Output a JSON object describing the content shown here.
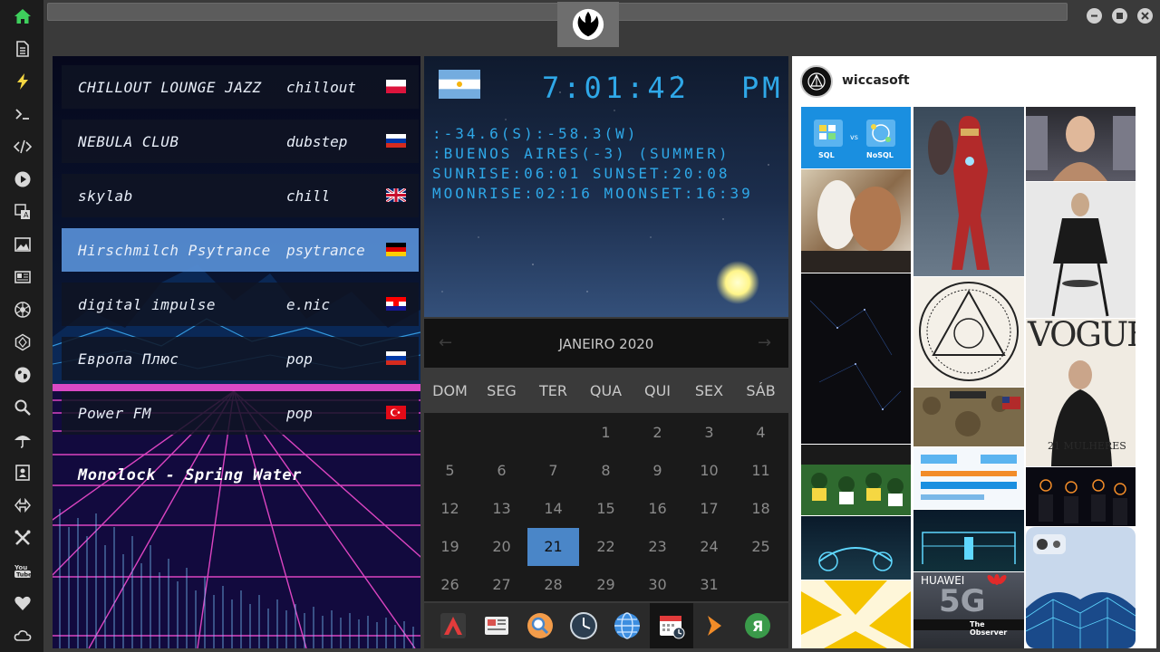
{
  "radio": {
    "stations": [
      {
        "name": "CHILLOUT LOUNGE JAZZ",
        "genre": "chillout",
        "flag": "poland"
      },
      {
        "name": "NEBULA CLUB",
        "genre": "dubstep",
        "flag": "russia"
      },
      {
        "name": "skylab",
        "genre": "chill",
        "flag": "uk"
      },
      {
        "name": "Hirschmilch Psytrance",
        "genre": "psytrance",
        "flag": "germany"
      },
      {
        "name": "digital impulse",
        "genre": "e.nic",
        "flag": "croatia"
      },
      {
        "name": "Европа Плюс",
        "genre": "pop",
        "flag": "russia"
      },
      {
        "name": "Power FM",
        "genre": "pop",
        "flag": "turkey"
      }
    ],
    "active_station": 3,
    "now_playing": "Monolock - Spring Water"
  },
  "clock": {
    "time": "7:01:42",
    "ampm": "PM",
    "coords": ":-34.6(S):-58.3(W)",
    "location": ":BUENOS AIRES(-3) (SUMMER)",
    "sun": "SUNRISE:06:01 SUNSET:20:08",
    "moon": "MOONRISE:02:16 MOONSET:16:39"
  },
  "calendar": {
    "month_label": "JANEIRO 2020",
    "prev_arrow": "←",
    "next_arrow": "→",
    "weekdays": [
      "DOM",
      "SEG",
      "TER",
      "QUA",
      "QUI",
      "SEX",
      "SÁB"
    ],
    "weeks": [
      [
        "",
        "",
        "",
        "1",
        "2",
        "3",
        "4"
      ],
      [
        "5",
        "6",
        "7",
        "8",
        "9",
        "10",
        "11"
      ],
      [
        "12",
        "13",
        "14",
        "15",
        "16",
        "17",
        "18"
      ],
      [
        "19",
        "20",
        "21",
        "22",
        "23",
        "24",
        "25"
      ],
      [
        "26",
        "27",
        "28",
        "29",
        "30",
        "31",
        ""
      ]
    ],
    "today": "21"
  },
  "insta": {
    "username": "wiccasoft",
    "sql_label": "SQL",
    "vs_label": "vs",
    "nosql_label": "NoSQL",
    "vogue_label": "VOGUE",
    "vogue_sub": "21 MULHERES",
    "huawei_label": "HUAWEI",
    "huawei_5g": "5G",
    "observer_label": "The Observer"
  },
  "sidebar_icons": [
    "home-icon",
    "document-icon",
    "lightning-icon",
    "terminal-icon",
    "code-icon",
    "play-icon",
    "translate-icon",
    "image-icon",
    "news-icon",
    "aperture-icon",
    "hexagon-icon",
    "globe-icon",
    "search-icon",
    "umbrella-icon",
    "contact-icon",
    "transfer-icon",
    "tools-icon",
    "youtube-icon",
    "heart-icon",
    "cloud-icon"
  ],
  "dock_icons": [
    "adobe-icon",
    "news-app-icon",
    "search-app-icon",
    "clock-app-icon",
    "globe-app-icon",
    "calendar-app-icon",
    "arrow-app-icon",
    "yandex-app-icon"
  ],
  "colors": {
    "accent": "#2fa8e8",
    "today": "#4a86c8",
    "home": "#3ecf5c",
    "lightning": "#f5d742"
  }
}
